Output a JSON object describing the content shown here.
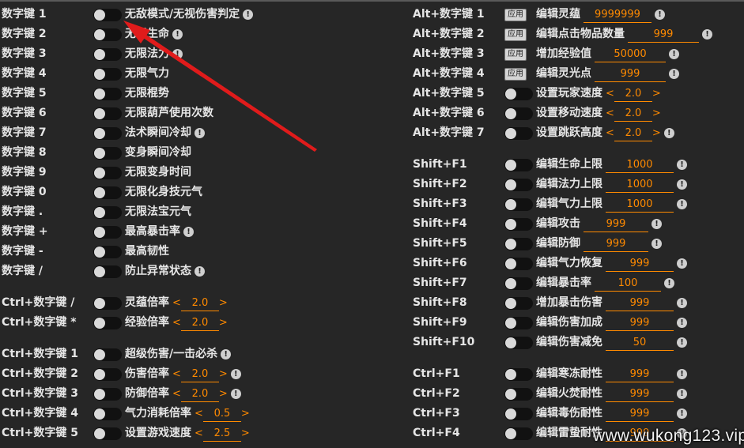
{
  "accent_color": "#ff8a00",
  "arrow_color": "#e01b1b",
  "apply_label": "应用",
  "left": [
    {
      "key": "数字键 1",
      "type": "toggle",
      "label": "无敌模式/无视伤害判定",
      "info": true
    },
    {
      "key": "数字键 2",
      "type": "toggle",
      "label": "无限生命",
      "info": true
    },
    {
      "key": "数字键 3",
      "type": "toggle",
      "label": "无限法力",
      "info": true
    },
    {
      "key": "数字键 4",
      "type": "toggle",
      "label": "无限气力"
    },
    {
      "key": "数字键 5",
      "type": "toggle",
      "label": "无限棍势"
    },
    {
      "key": "数字键 6",
      "type": "toggle",
      "label": "无限葫芦使用次数"
    },
    {
      "key": "数字键 7",
      "type": "toggle",
      "label": "法术瞬间冷却",
      "info": true
    },
    {
      "key": "数字键 8",
      "type": "toggle",
      "label": "变身瞬间冷却"
    },
    {
      "key": "数字键 9",
      "type": "toggle",
      "label": "无限变身时间"
    },
    {
      "key": "数字键 0",
      "type": "toggle",
      "label": "无限化身技元气"
    },
    {
      "key": "数字键 .",
      "type": "toggle",
      "label": "无限法宝元气"
    },
    {
      "key": "数字键 +",
      "type": "toggle",
      "label": "最高暴击率",
      "info": true
    },
    {
      "key": "数字键 -",
      "type": "toggle",
      "label": "最高韧性"
    },
    {
      "key": "数字键 /",
      "type": "toggle",
      "label": "防止异常状态",
      "info": true
    },
    {
      "gap": true
    },
    {
      "key": "Ctrl+数字键 /",
      "type": "toggle",
      "label": "灵蕴倍率",
      "stepper": "2.0"
    },
    {
      "key": "Ctrl+数字键 *",
      "type": "toggle",
      "label": "经验倍率",
      "stepper": "2.0"
    },
    {
      "gap": true
    },
    {
      "key": "Ctrl+数字键 1",
      "type": "toggle",
      "label": "超级伤害/一击必杀",
      "info": true
    },
    {
      "key": "Ctrl+数字键 2",
      "type": "toggle",
      "label": "伤害倍率",
      "stepper": "2.0",
      "info": true
    },
    {
      "key": "Ctrl+数字键 3",
      "type": "toggle",
      "label": "防御倍率",
      "stepper": "2.0",
      "info": true
    },
    {
      "key": "Ctrl+数字键 4",
      "type": "toggle",
      "label": "气力消耗倍率",
      "stepper": "0.5"
    },
    {
      "key": "Ctrl+数字键 5",
      "type": "toggle",
      "label": "设置游戏速度",
      "stepper": "2.5"
    }
  ],
  "right": [
    {
      "key": "Alt+数字键 1",
      "type": "apply",
      "label": "编辑灵蕴",
      "value": "9999999",
      "vw": "w86",
      "info": true
    },
    {
      "key": "Alt+数字键 2",
      "type": "apply",
      "label": "编辑点击物品数量",
      "value": "999",
      "vw": "w90",
      "info": true
    },
    {
      "key": "Alt+数字键 3",
      "type": "apply",
      "label": "增加经验值",
      "value": "50000",
      "vw": "w90",
      "info": true
    },
    {
      "key": "Alt+数字键 4",
      "type": "apply",
      "label": "编辑灵光点",
      "value": "999",
      "vw": "w90",
      "info": true
    },
    {
      "key": "Alt+数字键 5",
      "type": "toggle",
      "label": "设置玩家速度",
      "stepper": "2.0"
    },
    {
      "key": "Alt+数字键 6",
      "type": "toggle",
      "label": "设置移动速度",
      "stepper": "2.0"
    },
    {
      "key": "Alt+数字键 7",
      "type": "toggle",
      "label": "设置跳跃高度",
      "stepper": "2.0",
      "info": true
    },
    {
      "gap": true
    },
    {
      "key": "Shift+F1",
      "type": "toggle",
      "label": "编辑生命上限",
      "value": "1000",
      "vw": "w86",
      "info": true
    },
    {
      "key": "Shift+F2",
      "type": "toggle",
      "label": "编辑法力上限",
      "value": "1000",
      "vw": "w86",
      "info": true
    },
    {
      "key": "Shift+F3",
      "type": "toggle",
      "label": "编辑气力上限",
      "value": "1000",
      "vw": "w86",
      "info": true
    },
    {
      "key": "Shift+F4",
      "type": "toggle",
      "label": "编辑攻击",
      "value": "999",
      "vw": "w82",
      "info": true
    },
    {
      "key": "Shift+F5",
      "type": "toggle",
      "label": "编辑防御",
      "value": "999",
      "vw": "w82",
      "info": true
    },
    {
      "key": "Shift+F6",
      "type": "toggle",
      "label": "编辑气力恢复",
      "value": "999",
      "vw": "w86",
      "info": true
    },
    {
      "key": "Shift+F7",
      "type": "toggle",
      "label": "编辑暴击率",
      "value": "100",
      "vw": "w84",
      "info": true
    },
    {
      "key": "Shift+F8",
      "type": "toggle",
      "label": "增加暴击伤害",
      "value": "999",
      "vw": "w86",
      "info": true
    },
    {
      "key": "Shift+F9",
      "type": "toggle",
      "label": "编辑伤害加成",
      "value": "999",
      "vw": "w86",
      "info": true
    },
    {
      "key": "Shift+F10",
      "type": "toggle",
      "label": "编辑伤害减免",
      "value": "50",
      "vw": "w86",
      "info": true
    },
    {
      "gap": true
    },
    {
      "key": "Ctrl+F1",
      "type": "toggle",
      "label": "编辑寒冻耐性",
      "value": "999",
      "vw": "w86",
      "info": true
    },
    {
      "key": "Ctrl+F2",
      "type": "toggle",
      "label": "编辑火焚耐性",
      "value": "999",
      "vw": "w86",
      "info": true
    },
    {
      "key": "Ctrl+F3",
      "type": "toggle",
      "label": "编辑毒伤耐性",
      "value": "999",
      "vw": "w86",
      "info": true
    },
    {
      "key": "Ctrl+F4",
      "type": "toggle",
      "label": "编辑雷蛰耐性",
      "value": "999",
      "vw": "w86",
      "info": true
    }
  ],
  "watermark": "www.wukong123.vip"
}
